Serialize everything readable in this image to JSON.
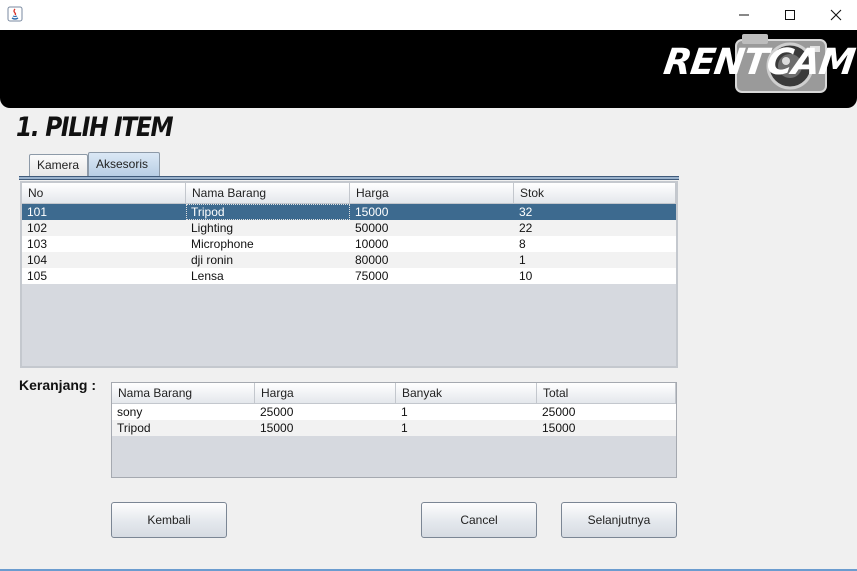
{
  "window": {
    "icon": "java-icon",
    "controls": [
      "minimize-icon",
      "maximize-icon",
      "close-icon"
    ]
  },
  "header": {
    "logo_text": "RENTCAM",
    "logo_icon": "camera-icon"
  },
  "page_title": "1. PILIH ITEM",
  "tabs": [
    {
      "label": "Kamera"
    },
    {
      "label": "Aksesoris"
    }
  ],
  "selected_tab": "Aksesoris",
  "items_table": {
    "columns": [
      "No",
      "Nama Barang",
      "Harga",
      "Stok"
    ],
    "rows": [
      [
        "101",
        "Tripod",
        "15000",
        "32"
      ],
      [
        "102",
        "Lighting",
        "50000",
        "22"
      ],
      [
        "103",
        "Microphone",
        "10000",
        "8"
      ],
      [
        "104",
        "dji ronin",
        "80000",
        "1"
      ],
      [
        "105",
        "Lensa",
        "75000",
        "10"
      ]
    ],
    "selected_row": "101"
  },
  "cart": {
    "label": "Keranjang :",
    "columns": [
      "Nama Barang",
      "Harga",
      "Banyak",
      "Total"
    ],
    "rows": [
      [
        "sony",
        "25000",
        "1",
        "25000"
      ],
      [
        "Tripod",
        "15000",
        "1",
        "15000"
      ]
    ]
  },
  "buttons": {
    "back": "Kembali",
    "cancel": "Cancel",
    "next": "Selanjutnya"
  },
  "colors": {
    "banner": "#000000",
    "selection": "#3d6a8f",
    "tab_active": "#b7cde4",
    "window_bg": "#f0f0f0"
  }
}
